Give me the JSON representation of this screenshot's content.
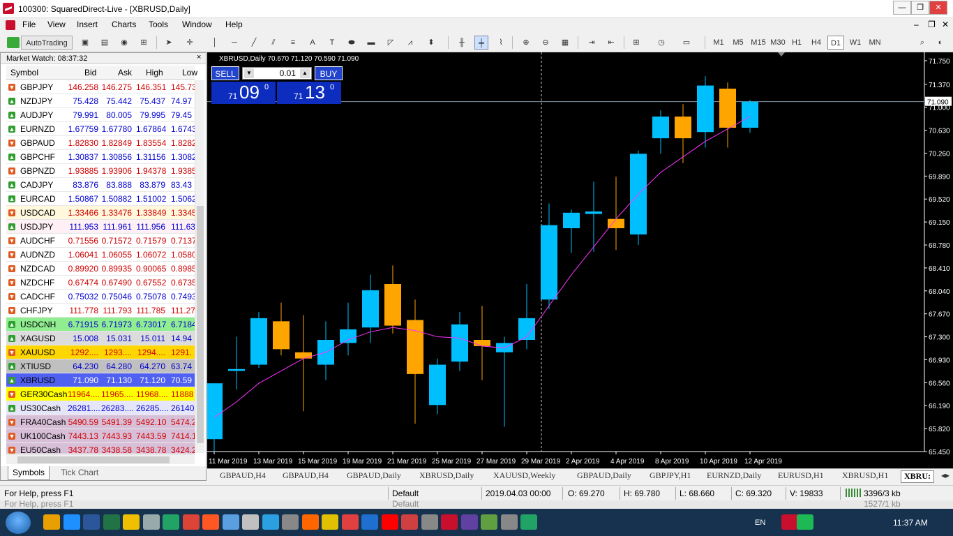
{
  "window": {
    "title": "100300: SquaredDirect-Live - [XBRUSD,Daily]",
    "min": "—",
    "max": "❐",
    "close": "✕",
    "inner_min": "–",
    "inner_max": "❐",
    "inner_close": "✕"
  },
  "menu": [
    "File",
    "View",
    "Insert",
    "Charts",
    "Tools",
    "Window",
    "Help"
  ],
  "toolbar": {
    "autotrading": "AutoTrading",
    "timeframes": [
      "M1",
      "M5",
      "M15",
      "M30",
      "H1",
      "H4",
      "D1",
      "W1",
      "MN"
    ],
    "active_timeframe": "D1"
  },
  "market_watch": {
    "title": "Market Watch: 08:37:32",
    "close": "×",
    "columns": [
      "Symbol",
      "Bid",
      "Ask",
      "High",
      "Low"
    ],
    "tabs": [
      "Symbols",
      "Tick Chart"
    ],
    "rows": [
      {
        "symbol": "GBPJPY",
        "bid": "146.258",
        "ask": "146.275",
        "high": "146.351",
        "low": "145.73",
        "dir": "down",
        "color": "#d00000",
        "bg": "#ffffff"
      },
      {
        "symbol": "NZDJPY",
        "bid": "75.428",
        "ask": "75.442",
        "high": "75.437",
        "low": "74.97",
        "dir": "up",
        "color": "#0000d0",
        "bg": "#ffffff"
      },
      {
        "symbol": "AUDJPY",
        "bid": "79.991",
        "ask": "80.005",
        "high": "79.995",
        "low": "79.45",
        "dir": "up",
        "color": "#0000d0",
        "bg": "#ffffff"
      },
      {
        "symbol": "EURNZD",
        "bid": "1.67759",
        "ask": "1.67780",
        "high": "1.67864",
        "low": "1.6743",
        "dir": "up",
        "color": "#0000d0",
        "bg": "#ffffff"
      },
      {
        "symbol": "GBPAUD",
        "bid": "1.82830",
        "ask": "1.82849",
        "high": "1.83554",
        "low": "1.8282",
        "dir": "down",
        "color": "#d00000",
        "bg": "#ffffff"
      },
      {
        "symbol": "GBPCHF",
        "bid": "1.30837",
        "ask": "1.30856",
        "high": "1.31156",
        "low": "1.3082",
        "dir": "up",
        "color": "#0000d0",
        "bg": "#ffffff"
      },
      {
        "symbol": "GBPNZD",
        "bid": "1.93885",
        "ask": "1.93906",
        "high": "1.94378",
        "low": "1.9385",
        "dir": "down",
        "color": "#d00000",
        "bg": "#ffffff"
      },
      {
        "symbol": "CADJPY",
        "bid": "83.876",
        "ask": "83.888",
        "high": "83.879",
        "low": "83.43",
        "dir": "up",
        "color": "#0000d0",
        "bg": "#ffffff"
      },
      {
        "symbol": "EURCAD",
        "bid": "1.50867",
        "ask": "1.50882",
        "high": "1.51002",
        "low": "1.5062",
        "dir": "up",
        "color": "#0000d0",
        "bg": "#ffffff"
      },
      {
        "symbol": "USDCAD",
        "bid": "1.33466",
        "ask": "1.33476",
        "high": "1.33849",
        "low": "1.3345",
        "dir": "down",
        "color": "#d00000",
        "bg": "#fff8dc"
      },
      {
        "symbol": "USDJPY",
        "bid": "111.953",
        "ask": "111.961",
        "high": "111.956",
        "low": "111.63",
        "dir": "up",
        "color": "#0000d0",
        "bg": "#fff0f5"
      },
      {
        "symbol": "AUDCHF",
        "bid": "0.71556",
        "ask": "0.71572",
        "high": "0.71579",
        "low": "0.7137",
        "dir": "down",
        "color": "#d00000",
        "bg": "#ffffff"
      },
      {
        "symbol": "AUDNZD",
        "bid": "1.06041",
        "ask": "1.06055",
        "high": "1.06072",
        "low": "1.0580",
        "dir": "down",
        "color": "#d00000",
        "bg": "#ffffff"
      },
      {
        "symbol": "NZDCAD",
        "bid": "0.89920",
        "ask": "0.89935",
        "high": "0.90065",
        "low": "0.8985",
        "dir": "down",
        "color": "#d00000",
        "bg": "#ffffff"
      },
      {
        "symbol": "NZDCHF",
        "bid": "0.67474",
        "ask": "0.67490",
        "high": "0.67552",
        "low": "0.6735",
        "dir": "down",
        "color": "#d00000",
        "bg": "#ffffff"
      },
      {
        "symbol": "CADCHF",
        "bid": "0.75032",
        "ask": "0.75046",
        "high": "0.75078",
        "low": "0.7493",
        "dir": "down",
        "color": "#0000d0",
        "bg": "#ffffff"
      },
      {
        "symbol": "CHFJPY",
        "bid": "111.778",
        "ask": "111.793",
        "high": "111.785",
        "low": "111.27",
        "dir": "down",
        "color": "#d00000",
        "bg": "#ffffff"
      },
      {
        "symbol": "USDCNH",
        "bid": "6.71915",
        "ask": "6.71973",
        "high": "6.73017",
        "low": "6.7184",
        "dir": "up",
        "color": "#0000d0",
        "bg": "#90ee90"
      },
      {
        "symbol": "XAGUSD",
        "bid": "15.008",
        "ask": "15.031",
        "high": "15.011",
        "low": "14.94",
        "dir": "up",
        "color": "#0000d0",
        "bg": "#dcdcdc"
      },
      {
        "symbol": "XAUUSD",
        "bid": "1292....",
        "ask": "1293....",
        "high": "1294....",
        "low": "1291.",
        "dir": "down",
        "color": "#d00000",
        "bg": "#ffd700"
      },
      {
        "symbol": "XTIUSD",
        "bid": "64.230",
        "ask": "64.280",
        "high": "64.270",
        "low": "63.74",
        "dir": "up",
        "color": "#0000d0",
        "bg": "#c0c0c0"
      },
      {
        "symbol": "XBRUSD",
        "bid": "71.090",
        "ask": "71.130",
        "high": "71.120",
        "low": "70.59",
        "dir": "up",
        "color": "#ffffff",
        "bg": "#5060f0"
      },
      {
        "symbol": "GER30Cash",
        "bid": "11964....",
        "ask": "11965....",
        "high": "11968....",
        "low": "11888",
        "dir": "down",
        "color": "#d00000",
        "bg": "#ffff00"
      },
      {
        "symbol": "US30Cash",
        "bid": "26281....",
        "ask": "26283....",
        "high": "26285....",
        "low": "26140",
        "dir": "up",
        "color": "#0000d0",
        "bg": "#e6e6fa"
      },
      {
        "symbol": "FRA40Cash",
        "bid": "5490.59",
        "ask": "5491.39",
        "high": "5492.10",
        "low": "5474.2",
        "dir": "down",
        "color": "#d00000",
        "bg": "#d8bfd8"
      },
      {
        "symbol": "UK100Cash",
        "bid": "7443.13",
        "ask": "7443.93",
        "high": "7443.59",
        "low": "7414.1",
        "dir": "down",
        "color": "#d00000",
        "bg": "#d8bfd8"
      },
      {
        "symbol": "EU50Cash",
        "bid": "3437.78",
        "ask": "3438.58",
        "high": "3438.78",
        "low": "3424.2",
        "dir": "down",
        "color": "#d00000",
        "bg": "#d8bfd8"
      }
    ]
  },
  "trade_panel": {
    "sell": "SELL",
    "buy": "BUY",
    "lot": "0.01",
    "sell_prefix": "71",
    "sell_big": "09",
    "sell_sup": "0",
    "buy_prefix": "71",
    "buy_big": "13",
    "buy_sup": "0"
  },
  "chart_data": {
    "type": "candlestick",
    "label": "XBRUSD,Daily  70.670 71.120 70.590 71.090",
    "current_price": "71.090",
    "y_ticks": [
      "71.750",
      "71.370",
      "71.000",
      "70.630",
      "70.260",
      "69.890",
      "69.520",
      "69.150",
      "68.780",
      "68.410",
      "68.040",
      "67.670",
      "67.300",
      "66.930",
      "66.560",
      "66.190",
      "65.820",
      "65.450"
    ],
    "x_ticks": [
      "11 Mar 2019",
      "13 Mar 2019",
      "15 Mar 2019",
      "19 Mar 2019",
      "21 Mar 2019",
      "25 Mar 2019",
      "27 Mar 2019",
      "29 Mar 2019",
      "2 Apr 2019",
      "4 Apr 2019",
      "8 Apr 2019",
      "10 Apr 2019",
      "12 Apr 2019"
    ],
    "ylim": [
      65.45,
      71.75
    ],
    "up_color": "#00bfff",
    "down_color": "#ffa500",
    "ma_color": "#ff33ff",
    "candles": [
      {
        "o": 65.65,
        "h": 66.55,
        "l": 65.45,
        "c": 66.55
      },
      {
        "o": 66.75,
        "h": 67.3,
        "l": 66.45,
        "c": 66.78
      },
      {
        "o": 66.85,
        "h": 67.7,
        "l": 66.8,
        "c": 67.6
      },
      {
        "o": 67.55,
        "h": 67.85,
        "l": 67.0,
        "c": 67.1
      },
      {
        "o": 67.05,
        "h": 67.65,
        "l": 66.1,
        "c": 66.95
      },
      {
        "o": 66.85,
        "h": 67.55,
        "l": 66.6,
        "c": 67.25
      },
      {
        "o": 67.2,
        "h": 67.85,
        "l": 67.0,
        "c": 67.42
      },
      {
        "o": 67.45,
        "h": 68.3,
        "l": 67.2,
        "c": 68.05
      },
      {
        "o": 68.15,
        "h": 68.45,
        "l": 67.35,
        "c": 67.48
      },
      {
        "o": 67.57,
        "h": 67.9,
        "l": 65.9,
        "c": 66.7
      },
      {
        "o": 66.2,
        "h": 66.95,
        "l": 66.05,
        "c": 66.85
      },
      {
        "o": 66.9,
        "h": 67.7,
        "l": 66.75,
        "c": 67.5
      },
      {
        "o": 67.25,
        "h": 67.8,
        "l": 66.6,
        "c": 67.15
      },
      {
        "o": 67.05,
        "h": 67.3,
        "l": 65.85,
        "c": 67.2
      },
      {
        "o": 67.25,
        "h": 68.15,
        "l": 67.1,
        "c": 67.6
      },
      {
        "o": 67.9,
        "h": 69.45,
        "l": 67.75,
        "c": 69.1
      },
      {
        "o": 69.05,
        "h": 69.35,
        "l": 68.65,
        "c": 69.3
      },
      {
        "o": 69.28,
        "h": 69.8,
        "l": 68.67,
        "c": 69.32
      },
      {
        "o": 69.2,
        "h": 69.88,
        "l": 68.7,
        "c": 69.05
      },
      {
        "o": 68.95,
        "h": 70.3,
        "l": 68.78,
        "c": 70.25
      },
      {
        "o": 70.5,
        "h": 70.95,
        "l": 70.25,
        "c": 70.85
      },
      {
        "o": 70.85,
        "h": 71.05,
        "l": 70.1,
        "c": 70.5
      },
      {
        "o": 70.6,
        "h": 71.5,
        "l": 70.35,
        "c": 71.35
      },
      {
        "o": 71.3,
        "h": 71.4,
        "l": 70.35,
        "c": 70.67
      },
      {
        "o": 70.67,
        "h": 71.12,
        "l": 70.59,
        "c": 71.09
      }
    ],
    "ma": [
      66.0,
      66.25,
      66.55,
      66.75,
      66.95,
      67.05,
      67.25,
      67.38,
      67.45,
      67.4,
      67.3,
      67.28,
      67.15,
      67.12,
      67.3,
      67.8,
      68.3,
      68.75,
      69.2,
      69.6,
      69.95,
      70.2,
      70.45,
      70.65,
      70.85
    ]
  },
  "chart_tabs": [
    "GBPAUD,H4",
    "GBPAUD,H4",
    "GBPAUD,Daily",
    "XBRUSD,Daily",
    "XAUUSD,Weekly",
    "GBPAUD,Daily",
    "GBPJPY,H1",
    "EURNZD,Daily",
    "EURUSD,H1",
    "XBRUSD,H1",
    "XBRU:"
  ],
  "status": {
    "help": "For Help, press F1",
    "profile": "Default",
    "datetime": "2019.04.03 00:00",
    "open": "O: 69.270",
    "high": "H: 69.780",
    "low": "L: 68.660",
    "close": "C: 69.320",
    "volume": "V: 19833",
    "traffic": "3396/3 kb",
    "ghost_help": "For Help, press F1",
    "ghost_profile": "Default",
    "ghost_traffic": "1527/1 kb"
  },
  "taskbar": {
    "lang": "EN",
    "clock": "11:37 AM",
    "icons": [
      "#e8a000",
      "#1e90ff",
      "#2b579a",
      "#217346",
      "#f0c000",
      "#9aa",
      "#21a366",
      "#db4437",
      "#ff5722",
      "#5aa0e0",
      "#c0c0c0",
      "#2aa0e0",
      "#888",
      "#ff6600",
      "#e0c000",
      "#e04040",
      "#1f6fd0",
      "#ff0000",
      "#d04040",
      "#888",
      "#c8102e",
      "#6040a0",
      "#60a040",
      "#888",
      "#21a366",
      "#c8102e",
      "#1db954"
    ]
  }
}
